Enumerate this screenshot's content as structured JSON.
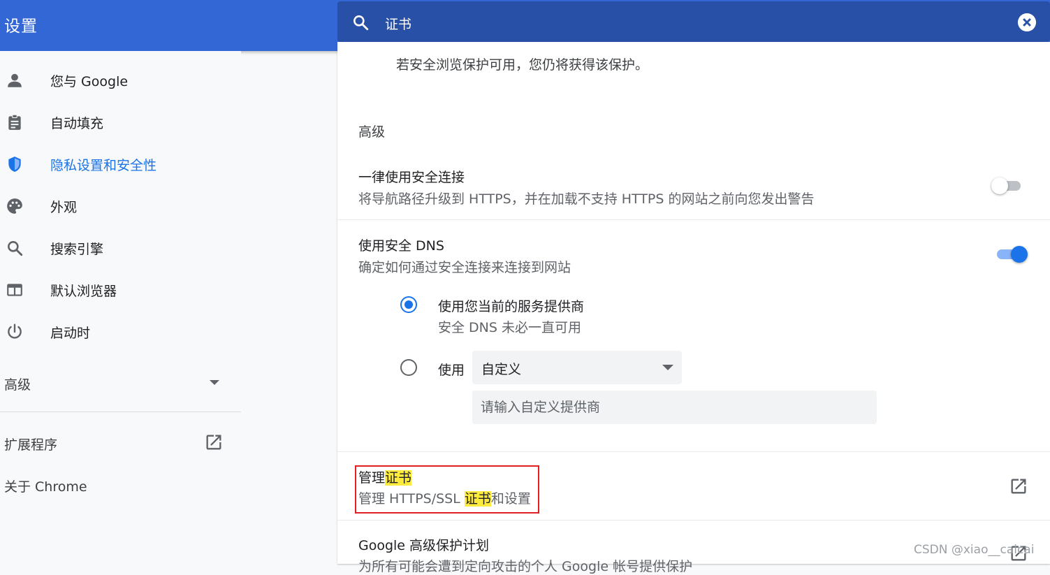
{
  "header": {
    "title": "设置",
    "search_value": "证书"
  },
  "sidebar": {
    "items": [
      {
        "label": "您与 Google",
        "icon": "person-icon"
      },
      {
        "label": "自动填充",
        "icon": "clipboard-icon"
      },
      {
        "label": "隐私设置和安全性",
        "icon": "shield-icon",
        "active": true
      },
      {
        "label": "外观",
        "icon": "palette-icon"
      },
      {
        "label": "搜索引擎",
        "icon": "search-icon"
      },
      {
        "label": "默认浏览器",
        "icon": "browser-icon"
      },
      {
        "label": "启动时",
        "icon": "power-icon"
      }
    ],
    "advanced_label": "高级",
    "extensions_label": "扩展程序",
    "about_label": "关于 Chrome"
  },
  "main": {
    "safe_browsing_note": "若安全浏览保护可用，您仍将获得该保护。",
    "advanced_heading": "高级",
    "https_title": "一律使用安全连接",
    "https_desc": "将导航路径升级到 HTTPS，并在加载不支持 HTTPS 的网站之前向您发出警告",
    "https_enabled": false,
    "dns_title": "使用安全 DNS",
    "dns_desc": "确定如何通过安全连接来连接到网站",
    "dns_enabled": true,
    "dns_option_current_title": "使用您当前的服务提供商",
    "dns_option_current_desc": "安全 DNS 未必一直可用",
    "dns_option_custom_label": "使用",
    "dns_custom_select_value": "自定义",
    "dns_custom_placeholder": "请输入自定义提供商",
    "cert_title_prefix": "管理",
    "cert_title_highlight": "证书",
    "cert_desc_prefix": "管理 HTTPS/SSL ",
    "cert_desc_highlight": "证书",
    "cert_desc_suffix": "和设置",
    "gapp_title": "Google 高级保护计划",
    "gapp_desc": "为所有可能会遭到定向攻击的个人 Google 帐号提供保护"
  },
  "watermark": "CSDN @xiao__caicai",
  "colors": {
    "header": "#3367d6",
    "search_box": "#2850a7",
    "accent": "#1a73e8",
    "highlight": "#ffeb3b",
    "annotation_box": "#e02020"
  }
}
